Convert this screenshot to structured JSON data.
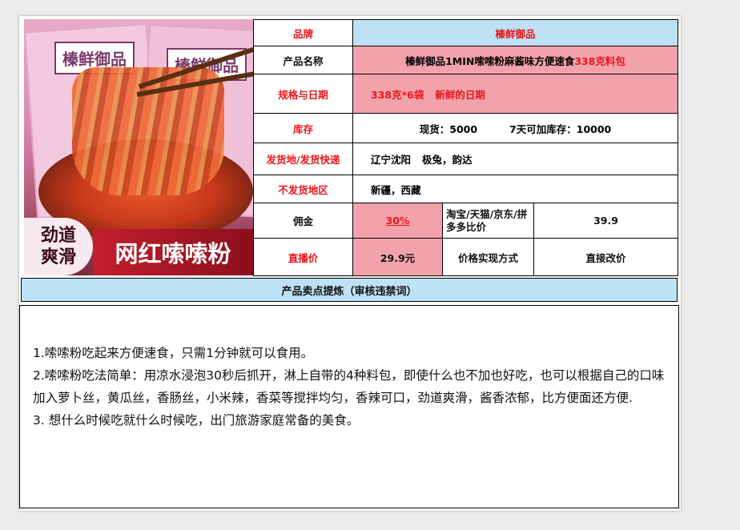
{
  "image": {
    "bag_brand": "榛鲜御品",
    "badge_line1": "劲道",
    "badge_line2": "爽滑",
    "banner": "网红嗦嗦粉"
  },
  "table": {
    "brand_label": "品牌",
    "brand_value": "榛鲜御品",
    "name_label": "产品名称",
    "name_value_main": "榛鲜御品1MIN嗦嗦粉麻酱味方便速食",
    "name_value_red": "338克料包",
    "spec_label": "规格与日期",
    "spec_value": "338克*6袋",
    "spec_date": "新鲜的日期",
    "stock_label": "库存",
    "stock_now": "现货：5000",
    "stock_7day": "7天可加库存：10000",
    "ship_label": "发货地/发货快递",
    "ship_place": "辽宁沈阳",
    "ship_express": "极兔，韵达",
    "noship_label": "不发货地区",
    "noship_value": "新疆，西藏",
    "commission_label": "佣金",
    "commission_value": "30%",
    "compare_label": "淘宝/天猫/京东/拼多多比价",
    "compare_value": "39.9",
    "live_price_label": "直播价",
    "live_price_value": "29.9元",
    "price_method_label": "价格实现方式",
    "price_method_value": "直接改价"
  },
  "section_header": "产品卖点提炼（审核违禁词）",
  "selling_points": [
    "1.嗦嗦粉吃起来方便速食，只需1分钟就可以食用。",
    "2.嗦嗦粉吃法简单：用凉水浸泡30秒后抓开，淋上自带的4种料包，即使什么也不加也好吃，也可以根据自己的口味加入萝卜丝，黄瓜丝，香肠丝，小米辣，香菜等搅拌均匀，香辣可口，劲道爽滑，酱香浓郁，比方便面还方便.",
    "3. 想什么时候吃就什么时候吃，出门旅游家庭常备的美食。"
  ]
}
